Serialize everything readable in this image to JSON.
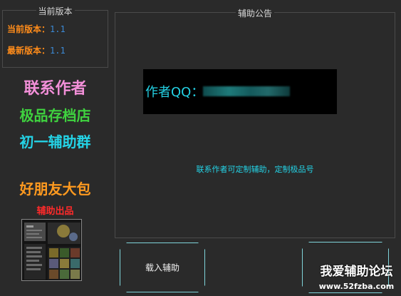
{
  "version_group": {
    "title": "当前版本",
    "current_label": "当前版本：",
    "current_value": "1.1",
    "latest_label": "最新版本：",
    "latest_value": "1.1"
  },
  "side_links": {
    "contact": "联系作者",
    "store": "极品存档店",
    "group": "初一辅助群",
    "friend": "好朋友大包",
    "made_by": "辅助出品"
  },
  "notice_group": {
    "title": "辅助公告",
    "qq_label": "作者QQ：",
    "notice_text": "联系作者可定制辅助，定制极品号"
  },
  "buttons": {
    "load": "载入辅助",
    "second": ""
  },
  "watermark": {
    "title": "我爱辅助论坛",
    "url": "www.52fzba.com"
  },
  "colors": {
    "background": "#2a2a2a",
    "cyan": "#24d3e6",
    "orange": "#ff8c1a",
    "pink": "#f28fd8",
    "green": "#3fd23f",
    "red": "#ff2a2a"
  }
}
